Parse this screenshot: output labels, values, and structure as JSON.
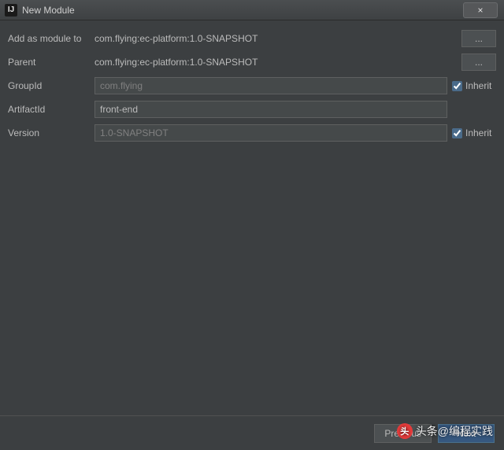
{
  "window": {
    "title": "New Module",
    "close_glyph": "×"
  },
  "form": {
    "add_as_module_label": "Add as module to",
    "add_as_module_value": "com.flying:ec-platform:1.0-SNAPSHOT",
    "parent_label": "Parent",
    "parent_value": "com.flying:ec-platform:1.0-SNAPSHOT",
    "groupid_label": "GroupId",
    "groupid_value": "com.flying",
    "groupid_inherit": true,
    "artifactid_label": "ArtifactId",
    "artifactid_value": "front-end",
    "version_label": "Version",
    "version_value": "1.0-SNAPSHOT",
    "version_inherit": true,
    "inherit_label": "Inherit",
    "ellipsis": "..."
  },
  "footer": {
    "previous": "Previous",
    "next": "Next"
  },
  "watermark": {
    "prefix": "头条",
    "handle": "@编程实践"
  }
}
